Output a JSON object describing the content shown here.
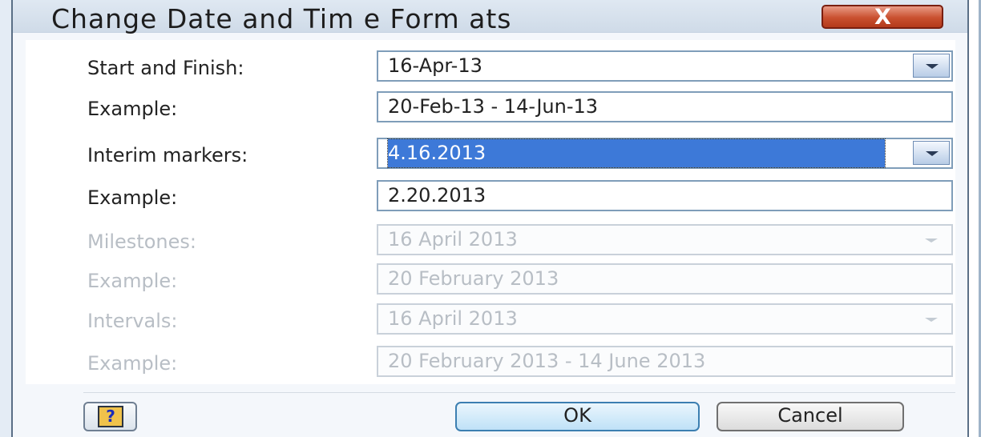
{
  "dialog": {
    "title": "Change Date and Tim e Form ats",
    "close_label": "X"
  },
  "fields": [
    {
      "label": "Start and Finish:",
      "value": "16-Apr-13",
      "type": "dropdown",
      "enabled": true
    },
    {
      "label": "Example:",
      "value": "20-Feb-13 - 14-Jun-13",
      "type": "readonly",
      "enabled": true
    },
    {
      "label": "Interim markers:",
      "value": "4.16.2013",
      "type": "dropdown",
      "enabled": true,
      "selected": true
    },
    {
      "label": "Example:",
      "value": "2.20.2013",
      "type": "readonly",
      "enabled": true
    },
    {
      "label": "Milestones:",
      "value": "16 April 2013",
      "type": "dropdown",
      "enabled": false
    },
    {
      "label": "Example:",
      "value": "20 February 2013",
      "type": "readonly",
      "enabled": false
    },
    {
      "label": "Intervals:",
      "value": "16 April 2013",
      "type": "dropdown",
      "enabled": false
    },
    {
      "label": "Example:",
      "value": "20 February 2013 - 14 June 2013",
      "type": "readonly",
      "enabled": false
    }
  ],
  "buttons": {
    "help_icon": "?",
    "ok": "OK",
    "cancel": "Cancel"
  },
  "colors": {
    "selection": "#3d79d8",
    "close_button": "#c9502f",
    "ok_border": "#3c7fb1"
  }
}
